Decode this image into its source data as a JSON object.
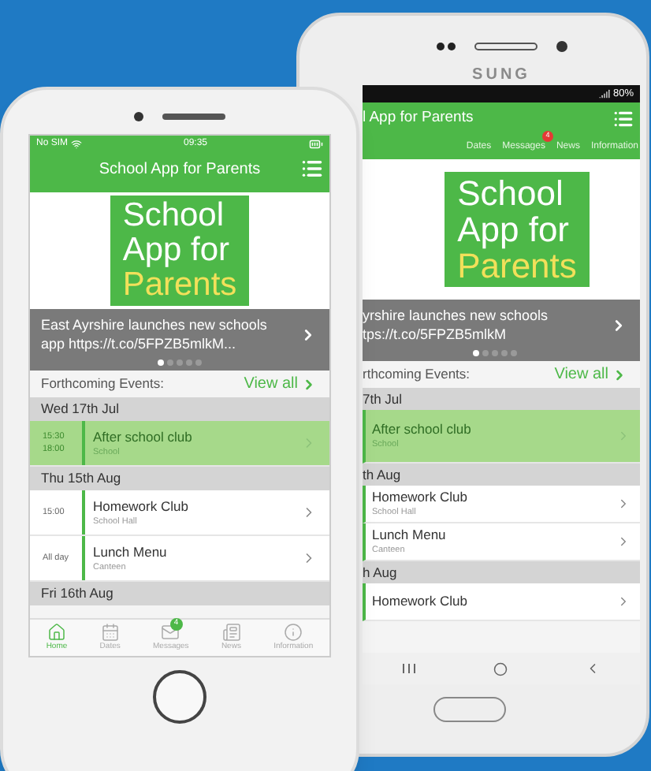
{
  "back_phone": {
    "brand": "SUNG",
    "battery": "80%",
    "title": "l App for Parents",
    "tabs": [
      {
        "label": "Dates",
        "selected": false
      },
      {
        "label": "Messages",
        "selected": false,
        "badge": "4"
      },
      {
        "label": "News",
        "selected": false
      },
      {
        "label": "Information",
        "selected": false
      }
    ],
    "logo": {
      "line_1": "School",
      "line_2": "App for",
      "line_3": "Parents"
    },
    "news_lines": [
      "yrshire launches new schools",
      "tps://t.co/5FPZB5mlkM"
    ],
    "dots": [
      {
        "selected": true
      },
      {
        "selected": false
      },
      {
        "selected": false
      },
      {
        "selected": false
      },
      {
        "selected": false
      }
    ],
    "events_label": "rthcoming Events:",
    "view_all": "View all",
    "sections": [
      {
        "date": "7th Jul",
        "events": [
          {
            "title": "After school club",
            "place": "School",
            "selected": true
          }
        ]
      },
      {
        "date": "th Aug",
        "events": [
          {
            "title": "Homework Club",
            "place": "School Hall",
            "selected": false
          },
          {
            "title": "Lunch Menu",
            "place": "Canteen",
            "selected": false
          }
        ]
      },
      {
        "date": "h Aug",
        "events": [
          {
            "title": "Homework Club",
            "selected": false
          }
        ]
      }
    ]
  },
  "front_phone": {
    "carrier": "No SIM",
    "time": "09:35",
    "title": "School App for Parents",
    "logo": {
      "line_1": "School",
      "line_2": "App for",
      "line_3": "Parents"
    },
    "news_lines": [
      "East Ayrshire launches new schools app https://t.co/5FPZB5mlkM..."
    ],
    "dots": [
      {
        "selected": true
      },
      {
        "selected": false
      },
      {
        "selected": false
      },
      {
        "selected": false
      },
      {
        "selected": false
      }
    ],
    "events_label": "Forthcoming Events:",
    "view_all": "View all",
    "sections": [
      {
        "date": "Wed 17th Jul",
        "events": [
          {
            "times": [
              "15:30",
              "18:00"
            ],
            "title": "After school club",
            "place": "School",
            "selected": true
          }
        ]
      },
      {
        "date": "Thu 15th Aug",
        "events": [
          {
            "times": [
              "15:00"
            ],
            "title": "Homework Club",
            "place": "School Hall",
            "selected": false
          },
          {
            "times": [
              "All day"
            ],
            "title": "Lunch Menu",
            "place": "Canteen",
            "selected": false
          }
        ]
      },
      {
        "date": "Fri 16th Aug"
      }
    ],
    "nav": [
      {
        "kind": "home",
        "label": "Home",
        "selected": true
      },
      {
        "kind": "dates",
        "label": "Dates",
        "selected": false
      },
      {
        "kind": "messages",
        "label": "Messages",
        "selected": false,
        "badge": "4"
      },
      {
        "kind": "news",
        "label": "News",
        "selected": false
      },
      {
        "kind": "info",
        "label": "Information",
        "selected": false
      }
    ]
  }
}
